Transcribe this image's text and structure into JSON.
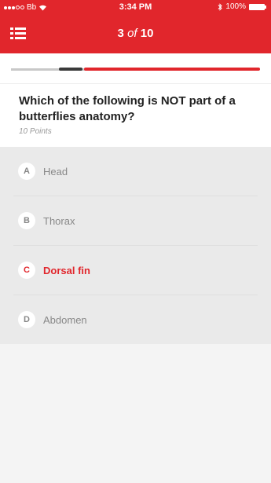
{
  "status_bar": {
    "carrier": "Bb",
    "time": "3:34 PM",
    "battery": "100%"
  },
  "nav": {
    "current": "3",
    "of": "of",
    "total": "10"
  },
  "progress": {
    "fraction": 0.3
  },
  "question": {
    "text": "Which of the following is NOT part of a butterflies anatomy?",
    "points": "10 Points"
  },
  "answers": [
    {
      "letter": "A",
      "label": "Head",
      "selected": false
    },
    {
      "letter": "B",
      "label": "Thorax",
      "selected": false
    },
    {
      "letter": "C",
      "label": "Dorsal fin",
      "selected": true
    },
    {
      "letter": "D",
      "label": "Abdomen",
      "selected": false
    }
  ],
  "colors": {
    "accent": "#e1262c",
    "muted": "#888888"
  },
  "icons": {
    "menu": "hamburger-list-icon",
    "wifi": "wifi-icon",
    "bluetooth": "bluetooth-icon",
    "battery": "battery-icon"
  }
}
